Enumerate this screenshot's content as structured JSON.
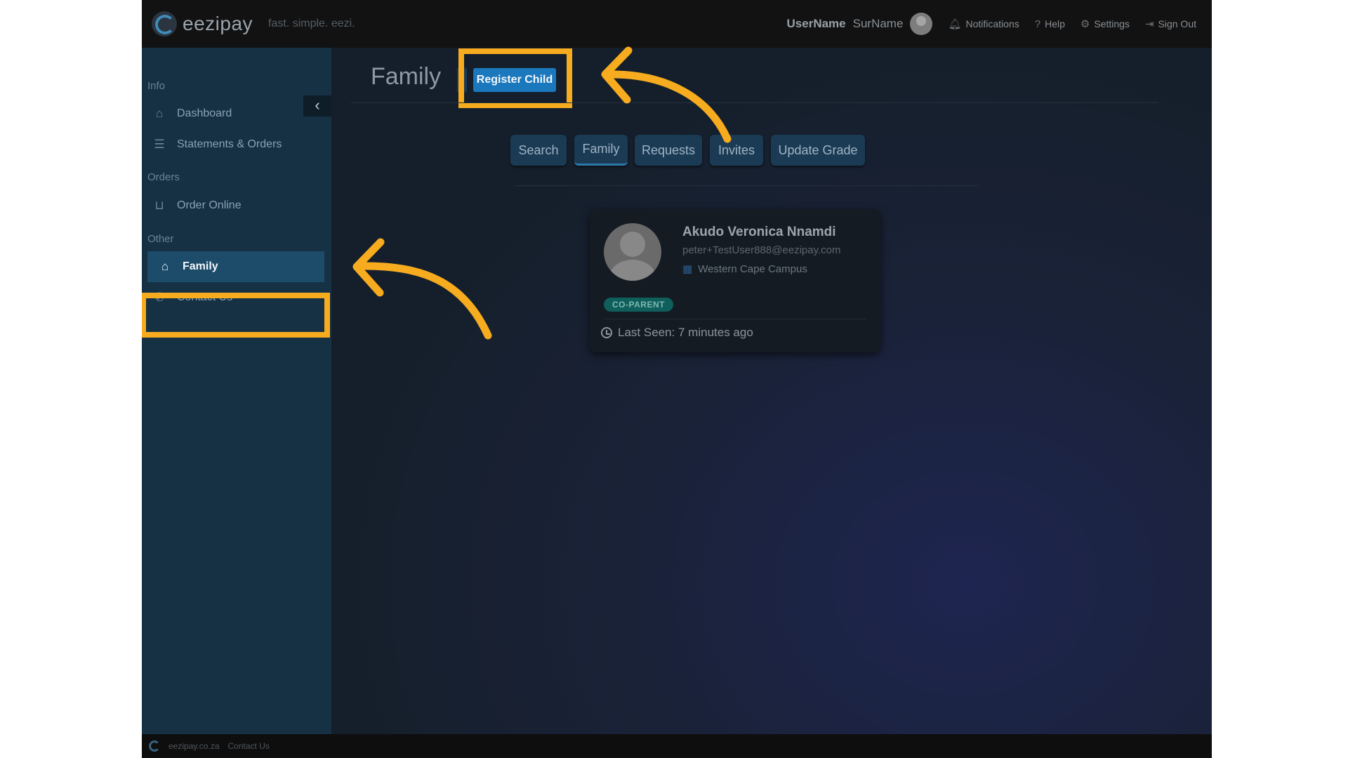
{
  "app": {
    "name": "eezipay",
    "tagline": "fast. simple. eezi."
  },
  "topnav": {
    "user_first": "UserName",
    "user_last": "SurName",
    "notifications": "Notifications",
    "help": "Help",
    "settings": "Settings",
    "sign_out": "Sign Out"
  },
  "sidebar": {
    "collapse_icon": "‹",
    "sections": {
      "info": "Info",
      "orders": "Orders",
      "other": "Other"
    },
    "items": {
      "dashboard": "Dashboard",
      "statements": "Statements & Orders",
      "order_online": "Order Online",
      "family": "Family",
      "contact": "Contact Us"
    }
  },
  "main": {
    "title": "Family",
    "register_button": "Register Child",
    "tabs": [
      "Search",
      "Family",
      "Requests",
      "Invites",
      "Update Grade"
    ],
    "active_tab": "Family"
  },
  "card": {
    "name": "Akudo Veronica Nnamdi",
    "email": "peter+TestUser888@eezipay.com",
    "campus": "Western Cape Campus",
    "badge": "CO-PARENT",
    "last_seen": "Last Seen: 7 minutes ago"
  },
  "footer": {
    "site": "eezipay.co.za",
    "contact": "Contact Us"
  },
  "colors": {
    "highlight": "#f7ac1f",
    "primary_button": "#1c78bd",
    "sidebar_active": "#1d4b6a",
    "badge": "#0f5f5d"
  }
}
